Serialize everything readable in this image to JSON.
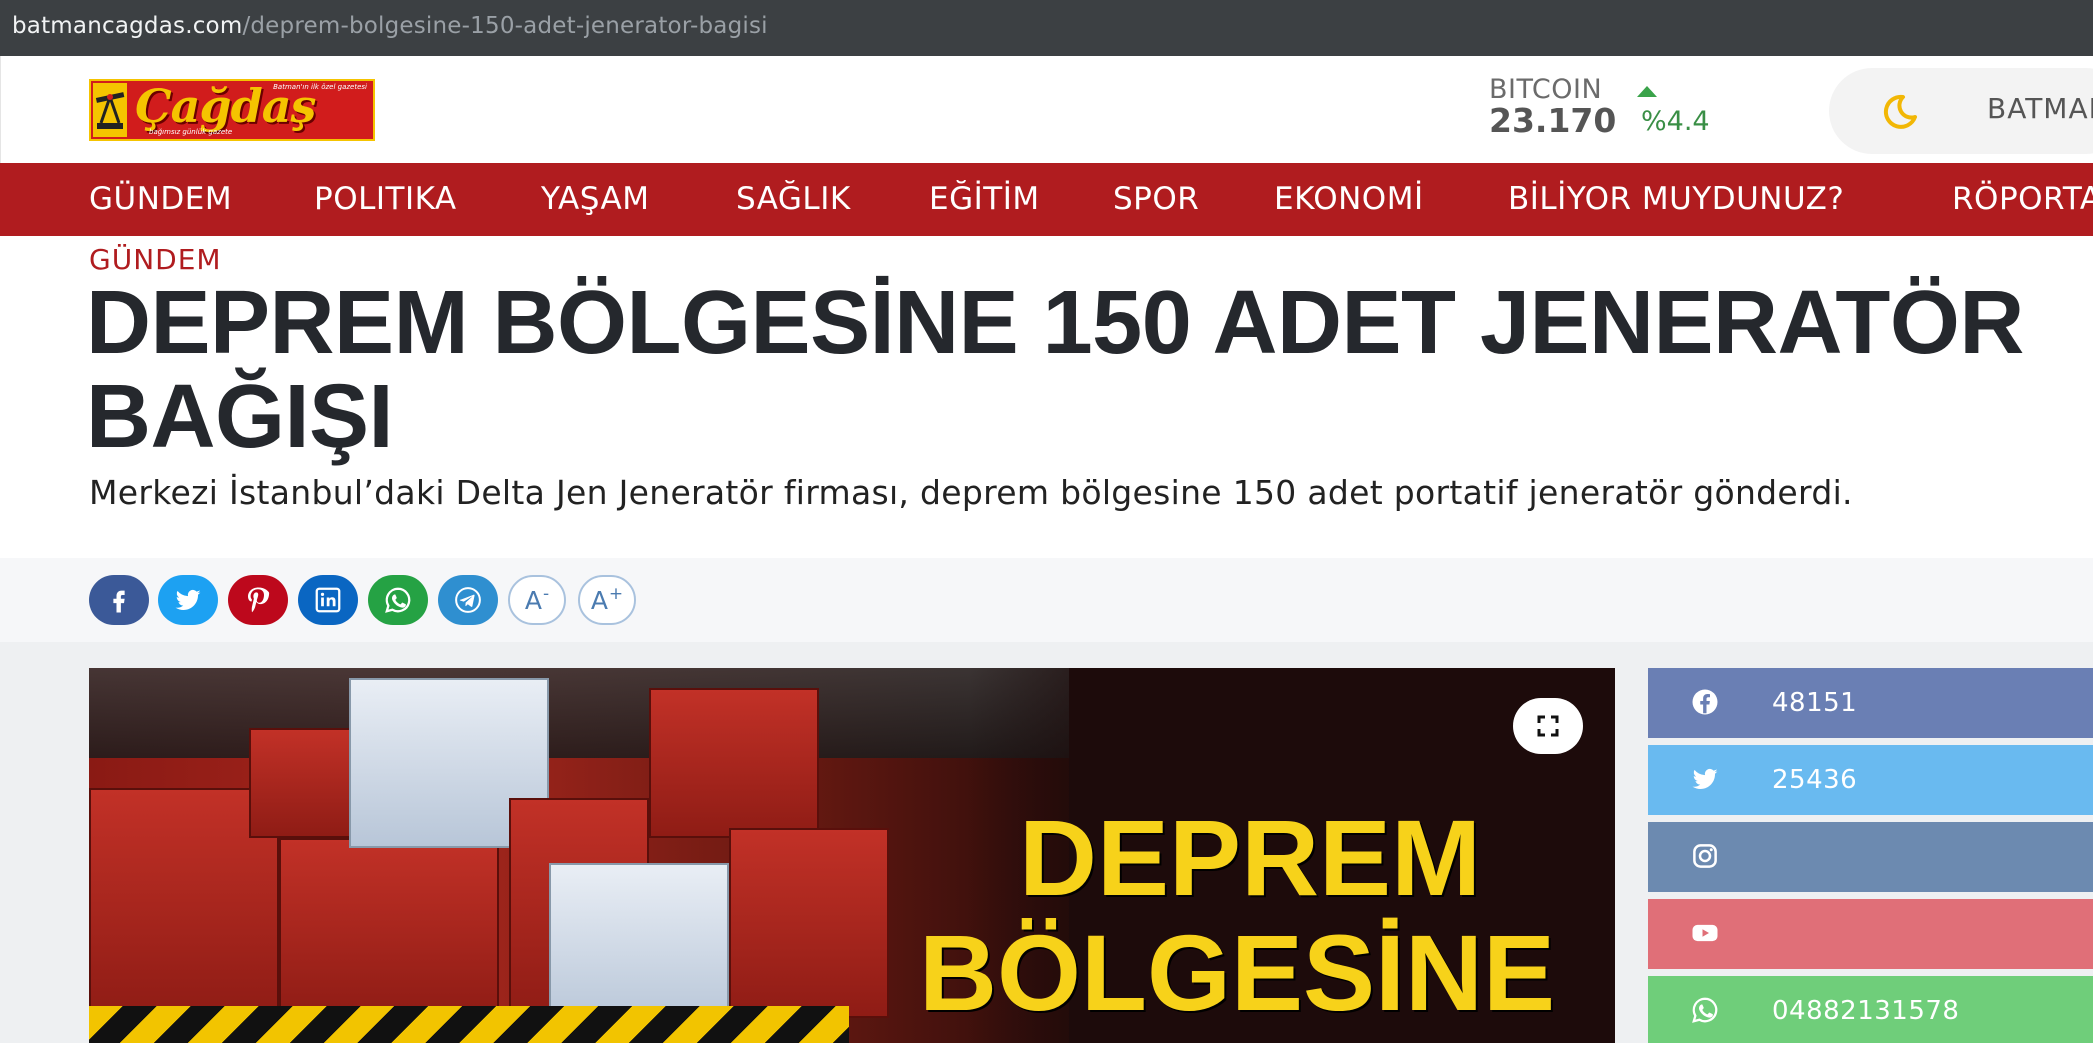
{
  "browser": {
    "url_host": "batmancagdas.com",
    "url_path": "/deprem-bolgesine-150-adet-jenerator-bagisi"
  },
  "logo": {
    "name": "Çağdaş",
    "tagline_top": "Batman'ın ilk özel gazetesi",
    "tagline_bottom": "bağımsız günlük gazete"
  },
  "ticker": {
    "name": "BITCOIN",
    "price": "23.170",
    "change": "%4.4",
    "direction": "up",
    "up_color": "#3aa34a"
  },
  "weather": {
    "city": "BATMAN",
    "icon": "moon-icon"
  },
  "nav": {
    "items": [
      "GÜNDEM",
      "POLITIKA",
      "YAŞAM",
      "SAĞLIK",
      "EĞİTİM",
      "SPOR",
      "EKONOMİ",
      "BİLİYOR MUYDUNUZ?",
      "RÖPORTAJ"
    ],
    "background": "#b01c1f"
  },
  "article": {
    "category": "GÜNDEM",
    "title_line1": "DEPREM BÖLGESİNE 150 ADET JENERATÖR",
    "title_line2": "BAĞIŞI",
    "summary": "Merkezi İstanbul’daki Delta Jen Jeneratör firması, deprem bölgesine 150 adet portatif jeneratör gönderdi."
  },
  "share": {
    "buttons": [
      {
        "name": "facebook",
        "icon": "facebook-icon",
        "color": "#3b5998"
      },
      {
        "name": "twitter",
        "icon": "twitter-icon",
        "color": "#1da1f2"
      },
      {
        "name": "pinterest",
        "icon": "pinterest-icon",
        "color": "#bd081c"
      },
      {
        "name": "linkedin",
        "icon": "linkedin-icon",
        "color": "#0a66c2"
      },
      {
        "name": "whatsapp",
        "icon": "whatsapp-icon",
        "color": "#25d366"
      },
      {
        "name": "telegram",
        "icon": "telegram-icon",
        "color": "#2f8fd0"
      }
    ],
    "font_decrease": "A",
    "font_decrease_sup": "-",
    "font_increase": "A",
    "font_increase_sup": "+"
  },
  "hero": {
    "overlay_line1": "DEPREM",
    "overlay_line2": "BÖLGESİNE",
    "overlay_color": "#f7d21a"
  },
  "social_counts": [
    {
      "network": "facebook",
      "icon": "facebook-icon",
      "count": "48151",
      "color": "#6a7fb4"
    },
    {
      "network": "twitter",
      "icon": "twitter-icon",
      "count": "25436",
      "color": "#69baf0"
    },
    {
      "network": "instagram",
      "icon": "instagram-icon",
      "count": "",
      "color": "#6c8ab0"
    },
    {
      "network": "youtube",
      "icon": "youtube-icon",
      "count": "",
      "color": "#e06f78"
    },
    {
      "network": "whatsapp",
      "icon": "whatsapp-icon",
      "count": "04882131578",
      "color": "#6fce7a"
    }
  ]
}
